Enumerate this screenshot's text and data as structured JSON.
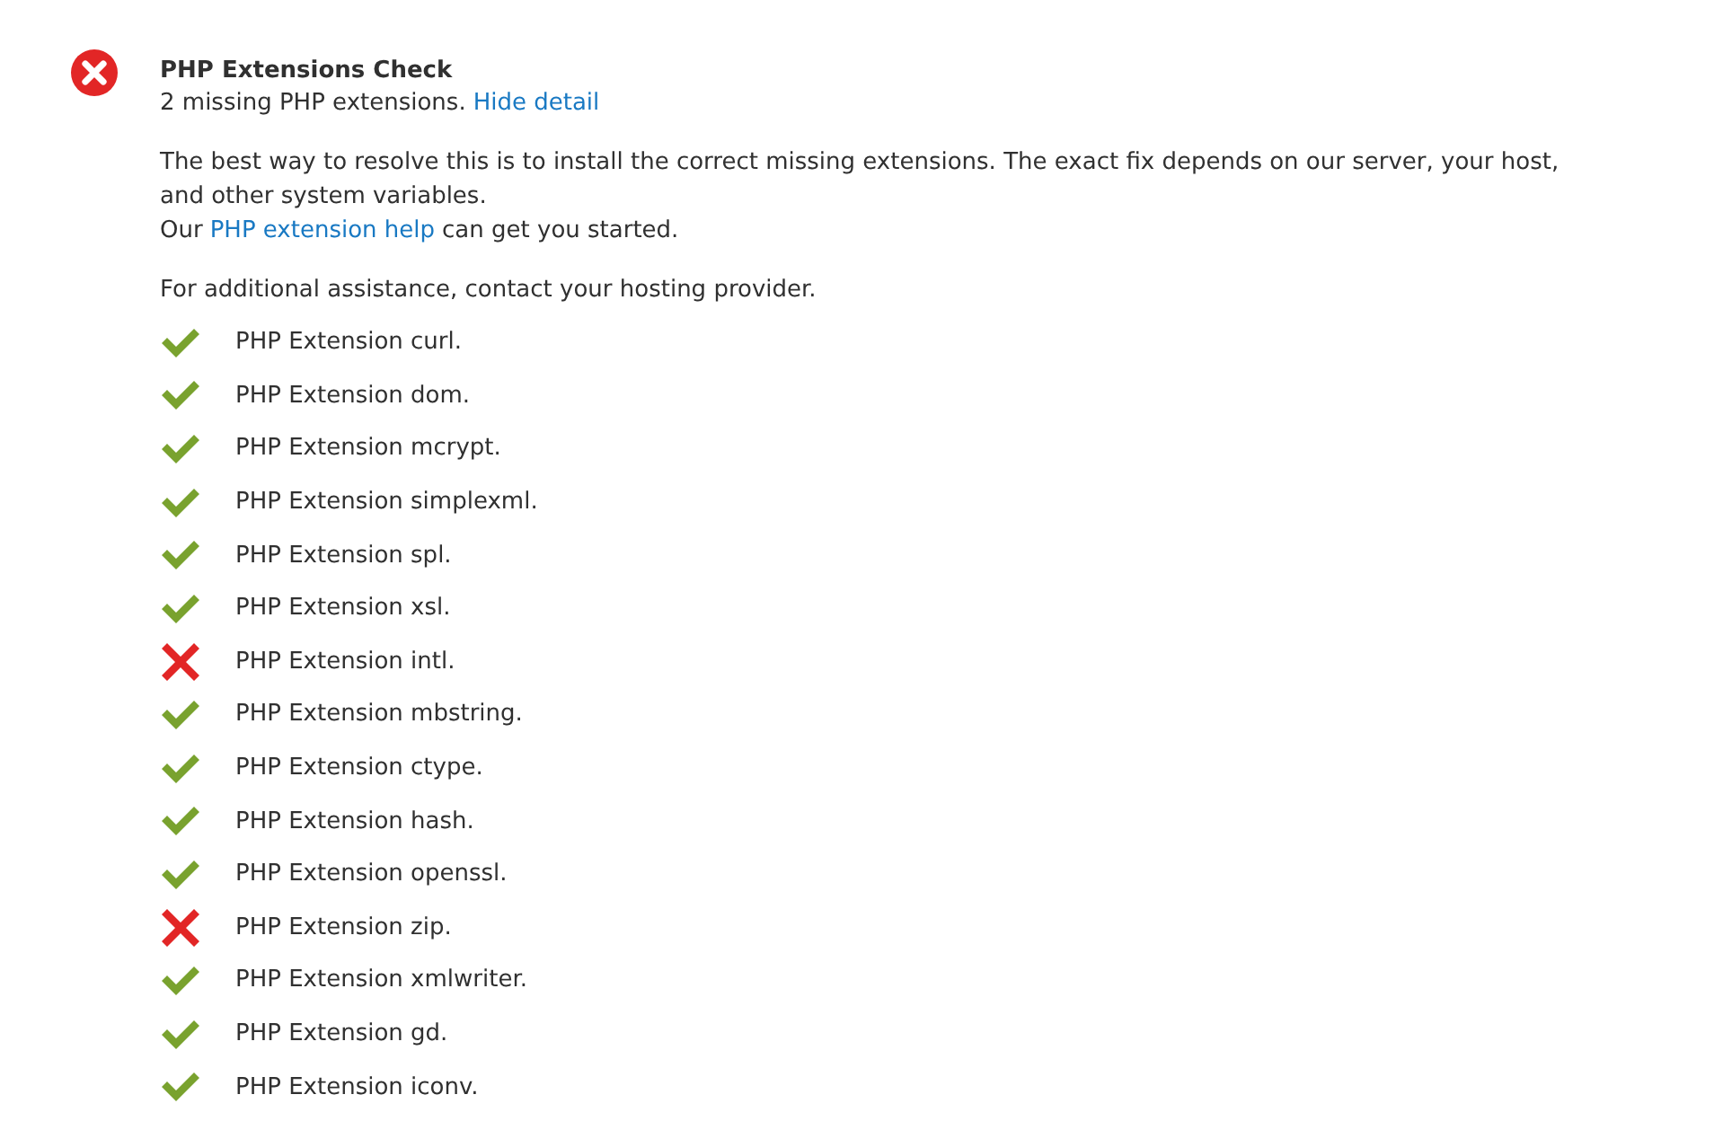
{
  "check": {
    "title": "PHP Extensions Check",
    "passed": false,
    "summary": "2 missing PHP extensions.",
    "toggle_link": "Hide detail",
    "description_lines": [
      "The best way to resolve this is to install the correct missing extensions. The exact fix depends on our server, your host,",
      "and other system variables."
    ],
    "help": {
      "before": "Our",
      "link": "PHP extension help",
      "after": "can get you started."
    },
    "assistance": "For additional assistance, contact your hosting provider.",
    "extensions": [
      {
        "label": "PHP Extension curl.",
        "installed": true
      },
      {
        "label": "PHP Extension dom.",
        "installed": true
      },
      {
        "label": "PHP Extension mcrypt.",
        "installed": true
      },
      {
        "label": "PHP Extension simplexml.",
        "installed": true
      },
      {
        "label": "PHP Extension spl.",
        "installed": true
      },
      {
        "label": "PHP Extension xsl.",
        "installed": true
      },
      {
        "label": "PHP Extension intl.",
        "installed": false
      },
      {
        "label": "PHP Extension mbstring.",
        "installed": true
      },
      {
        "label": "PHP Extension ctype.",
        "installed": true
      },
      {
        "label": "PHP Extension hash.",
        "installed": true
      },
      {
        "label": "PHP Extension openssl.",
        "installed": true
      },
      {
        "label": "PHP Extension zip.",
        "installed": false
      },
      {
        "label": "PHP Extension xmlwriter.",
        "installed": true
      },
      {
        "label": "PHP Extension gd.",
        "installed": true
      },
      {
        "label": "PHP Extension iconv.",
        "installed": true
      }
    ]
  }
}
